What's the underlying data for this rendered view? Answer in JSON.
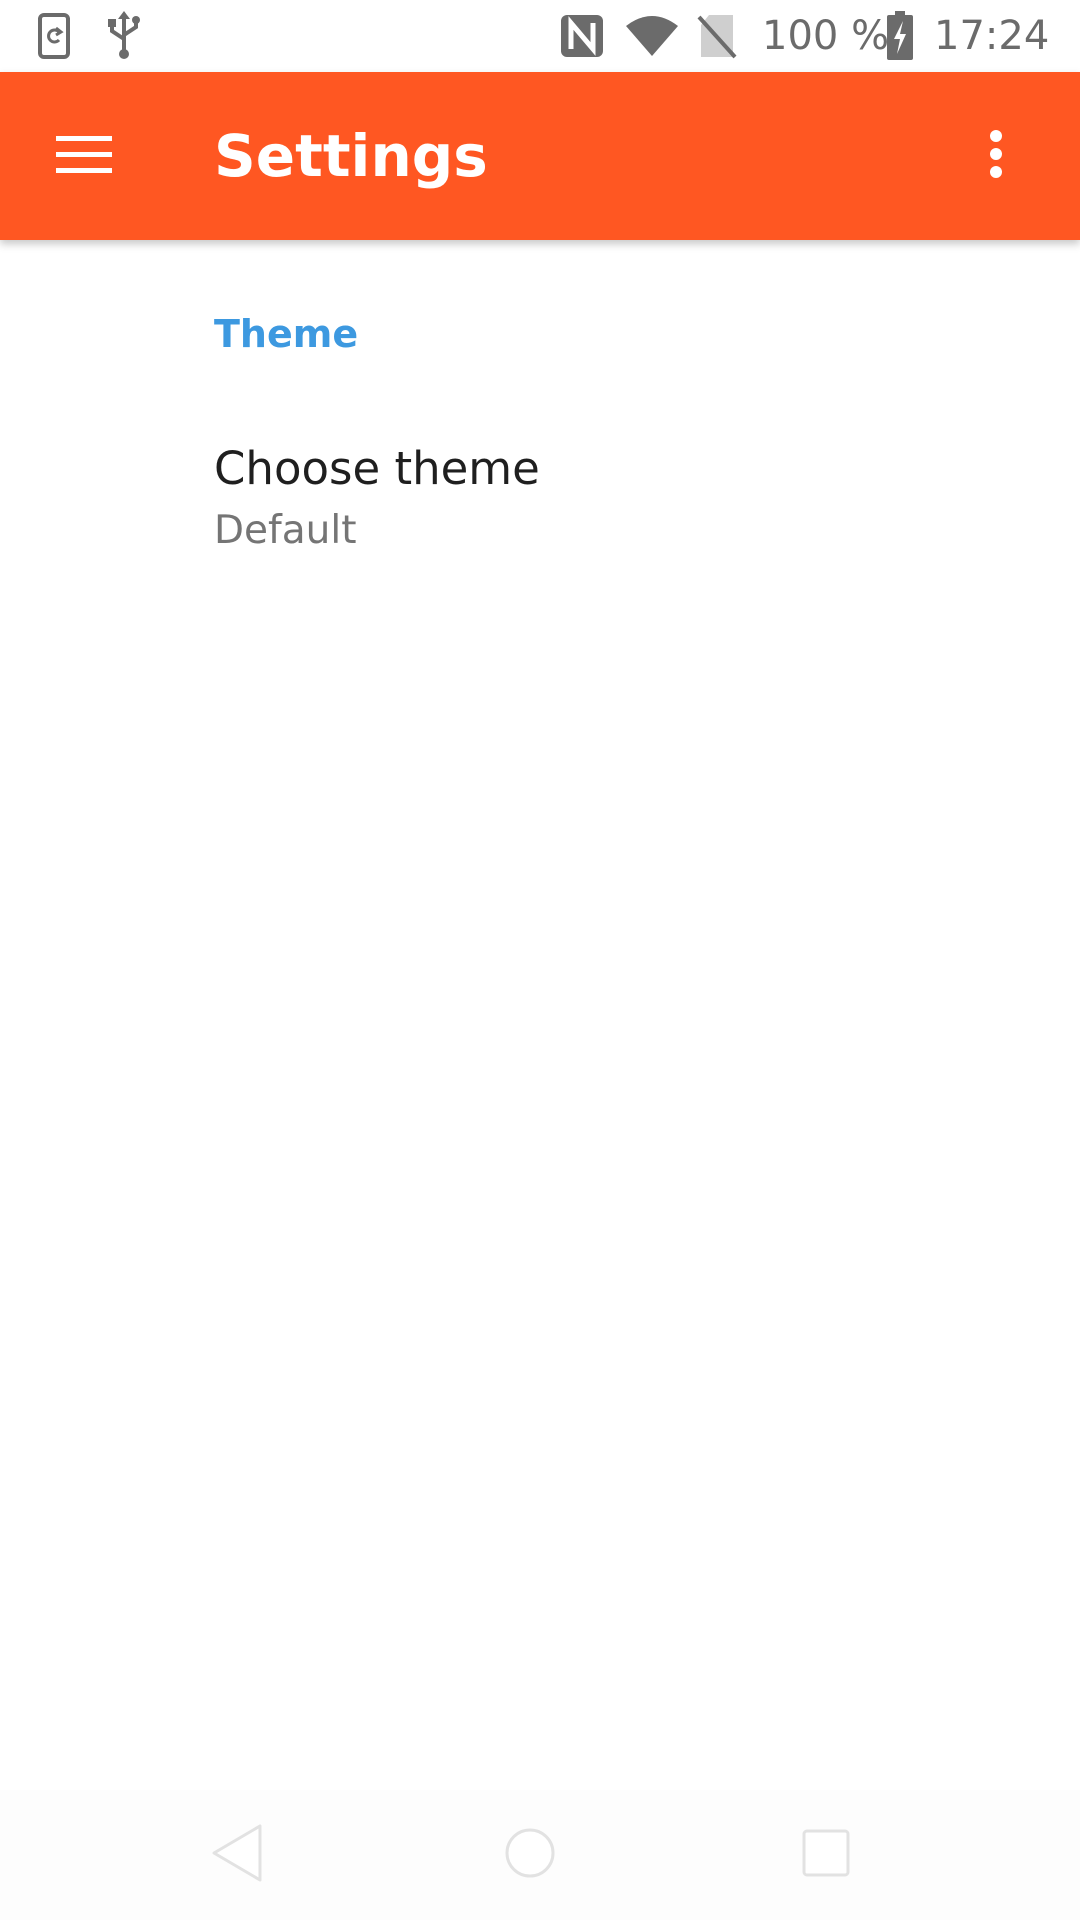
{
  "status_bar": {
    "left_icons": [
      "screen-rotate-icon",
      "usb-icon"
    ],
    "right_icons": [
      "nfc-icon",
      "wifi-icon",
      "no-sim-icon",
      "battery-charging-icon"
    ],
    "battery_text": "100 %",
    "time": "17:24"
  },
  "app_bar": {
    "title": "Settings",
    "background_color": "#ff5722",
    "menu_icon": "hamburger-menu-icon",
    "overflow_icon": "more-vert-icon"
  },
  "settings": {
    "section_title": "Theme",
    "section_color": "#3d99e0",
    "items": [
      {
        "title": "Choose theme",
        "summary": "Default"
      }
    ]
  },
  "nav_bar": {
    "buttons": [
      "back-icon",
      "home-icon",
      "recents-icon"
    ]
  }
}
